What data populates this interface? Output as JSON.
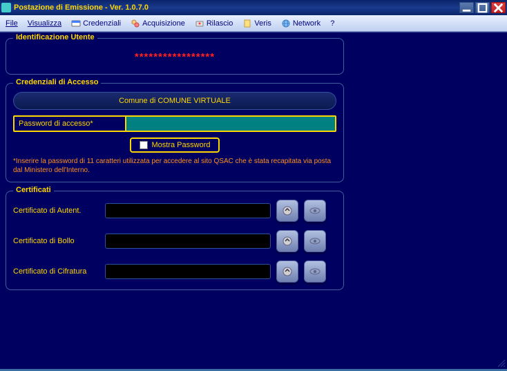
{
  "window": {
    "title": "Postazione di Emissione - Ver. 1.0.7.0"
  },
  "menu": {
    "file": "File",
    "visualizza": "Visualizza",
    "credenziali": "Credenziali",
    "acquisizione": "Acquisizione",
    "rilascio": "Rilascio",
    "veris": "Veris",
    "network": "Network",
    "help": "?"
  },
  "identificazione": {
    "legend": "Identificazione Utente",
    "value": "*****************"
  },
  "credenziali": {
    "legend": "Credenziali di Accesso",
    "comune": "Comune di COMUNE VIRTUALE",
    "password_label": "Password di accesso*",
    "password_value": "",
    "show_password": "Mostra Password",
    "hint": "*Inserire la password di 11 caratteri utilizzata per accedere al sito QSAC che è stata recapitata via posta dal Ministero dell'Interno."
  },
  "certificati": {
    "legend": "Certificati",
    "rows": [
      {
        "label": "Certificato di Autent.",
        "value": ""
      },
      {
        "label": "Certificato di Bollo",
        "value": ""
      },
      {
        "label": "Certificato di Cifratura",
        "value": ""
      }
    ]
  }
}
